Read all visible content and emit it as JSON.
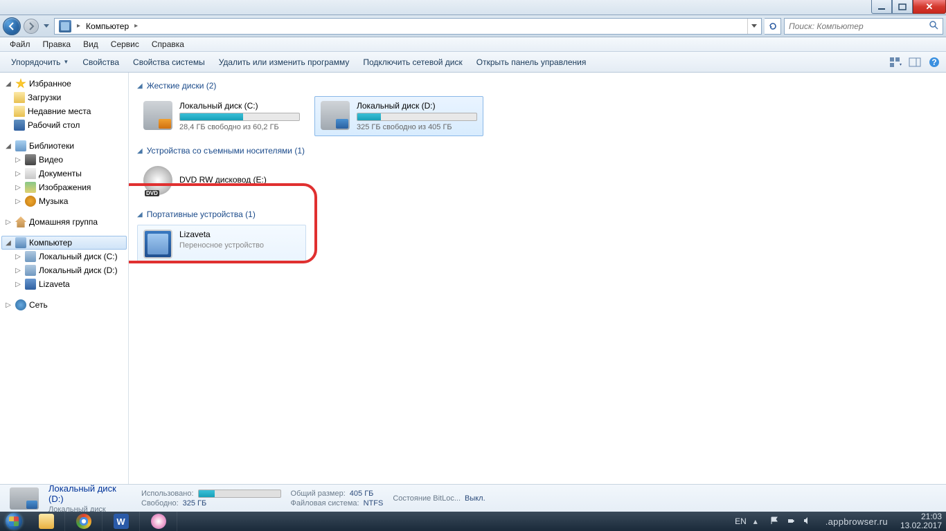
{
  "window": {
    "minimize": "_",
    "maximize": "□",
    "close": "✕"
  },
  "breadcrumb": {
    "root": "Компьютер"
  },
  "search": {
    "placeholder": "Поиск: Компьютер"
  },
  "menu": {
    "file": "Файл",
    "edit": "Правка",
    "view": "Вид",
    "tools": "Сервис",
    "help": "Справка"
  },
  "toolbar": {
    "organize": "Упорядочить",
    "properties": "Свойства",
    "sysproperties": "Свойства системы",
    "uninstall": "Удалить или изменить программу",
    "mapdrive": "Подключить сетевой диск",
    "controlpanel": "Открыть панель управления"
  },
  "sidebar": {
    "favorites": "Избранное",
    "downloads": "Загрузки",
    "recent": "Недавние места",
    "desktop": "Рабочий стол",
    "libraries": "Библиотеки",
    "videos": "Видео",
    "documents": "Документы",
    "pictures": "Изображения",
    "music": "Музыка",
    "homegroup": "Домашняя группа",
    "computer": "Компьютер",
    "driveC": "Локальный диск (C:)",
    "driveD": "Локальный диск (D:)",
    "lizaveta": "Lizaveta",
    "network": "Сеть"
  },
  "groups": {
    "hdd": "Жесткие диски (2)",
    "removable": "Устройства со съемными носителями (1)",
    "portable": "Портативные устройства (1)"
  },
  "drives": {
    "c": {
      "name": "Локальный диск (C:)",
      "free": "28,4 ГБ свободно из 60,2 ГБ",
      "fill": 53
    },
    "d": {
      "name": "Локальный диск (D:)",
      "free": "325 ГБ свободно из 405 ГБ",
      "fill": 20
    },
    "dvd": {
      "name": "DVD RW дисковод (E:)"
    },
    "port": {
      "name": "Lizaveta",
      "sub": "Переносное устройство"
    }
  },
  "details": {
    "name": "Локальный диск (D:)",
    "type": "Локальный диск",
    "used_lbl": "Использовано:",
    "free_lbl": "Свободно:",
    "free_val": "325 ГБ",
    "total_lbl": "Общий размер:",
    "total_val": "405 ГБ",
    "fs_lbl": "Файловая система:",
    "fs_val": "NTFS",
    "bitlocker_lbl": "Состояние BitLoc...",
    "bitlocker_val": "Выкл.",
    "fill": 20
  },
  "taskbar": {
    "lang": "EN",
    "time": "21:03",
    "date": "13.02.2017",
    "watermark": ".appbrowser.ru"
  }
}
